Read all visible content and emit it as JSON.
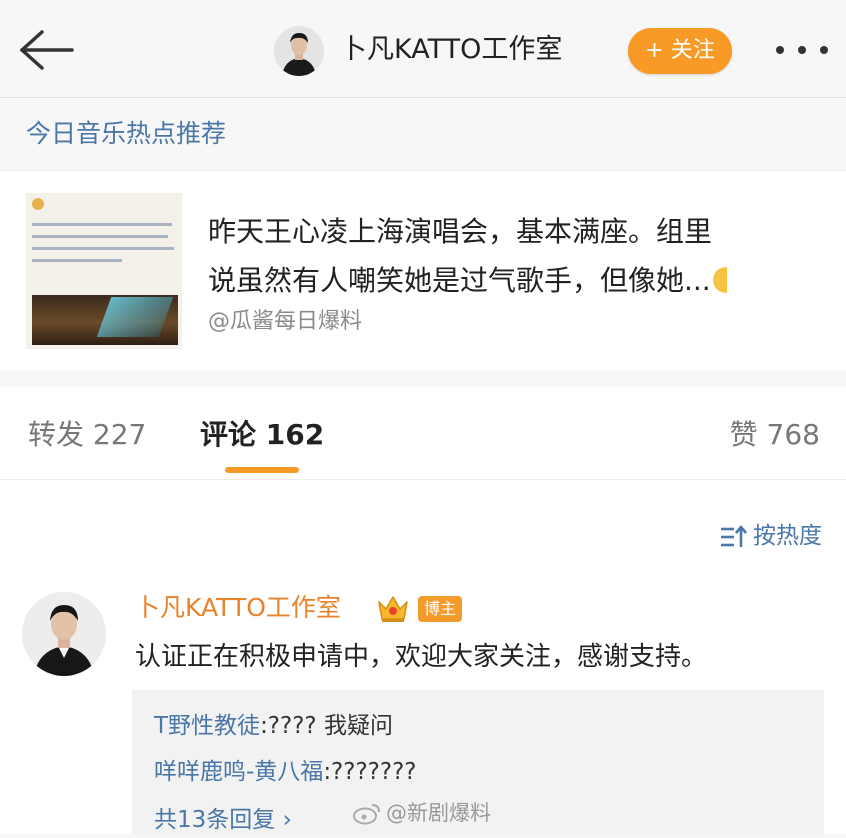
{
  "header": {
    "title": "卜凡KATTO工作室",
    "follow_label": "+ 关注"
  },
  "topic": {
    "label": "今日音乐热点推荐"
  },
  "card": {
    "line1": "昨天王心凌上海演唱会，基本满座。组里",
    "line2": "说虽然有人嘲笑她是过气歌手，但像她...",
    "source": "@瓜酱每日爆料"
  },
  "tabs": {
    "repost": "转发 227",
    "comment": "评论 162",
    "like": "赞 768"
  },
  "sort_label": "按热度",
  "comment": {
    "author": "卜凡KATTO工作室",
    "badge": "博主",
    "text": "认证正在积极申请中，欢迎大家关注，感谢支持。",
    "replies": [
      {
        "user": "T野性教徒",
        "text": ":???? 我疑问"
      },
      {
        "user": "咩咩鹿鸣-黄八福",
        "text": ":???????"
      }
    ],
    "more_replies": "共13条回复 ›"
  },
  "watermark": "@新剧爆料",
  "colors": {
    "accent": "#f89a26",
    "link": "#4a77a8",
    "author": "#e8832b"
  }
}
